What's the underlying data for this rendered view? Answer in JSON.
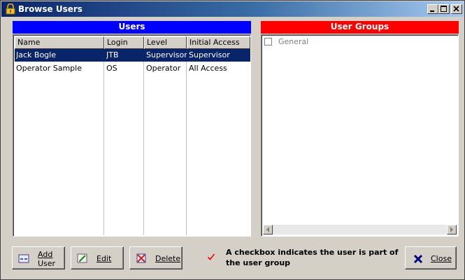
{
  "window": {
    "title": "Browse Users"
  },
  "users_panel": {
    "header": "Users",
    "columns": [
      "Name",
      "Login",
      "Level",
      "Initial Access"
    ],
    "rows": [
      {
        "name": "Jack Bogle",
        "login": "JTB",
        "level": "Supervisor",
        "initial_access": "Supervisor",
        "selected": true
      },
      {
        "name": "Operator Sample",
        "login": "OS",
        "level": "Operator",
        "initial_access": "All Access",
        "selected": false
      }
    ]
  },
  "groups_panel": {
    "header": "User Groups",
    "items": [
      {
        "label": "General",
        "checked": false
      }
    ]
  },
  "buttons": {
    "add_line1": "Add",
    "add_line2": "User",
    "edit": "Edit",
    "delete": "Delete",
    "close": "Close"
  },
  "info": {
    "text": "A checkbox indicates the user is part of the user group"
  },
  "colors": {
    "users_header": "#0000ff",
    "groups_header": "#ff0000",
    "selection": "#0a246a",
    "check_mark": "#ff0000"
  },
  "icons": {
    "window": "lock-icon",
    "add": "add-user-icon",
    "edit": "edit-icon",
    "delete": "delete-icon",
    "close": "close-x-icon",
    "info": "checkmark-icon"
  }
}
